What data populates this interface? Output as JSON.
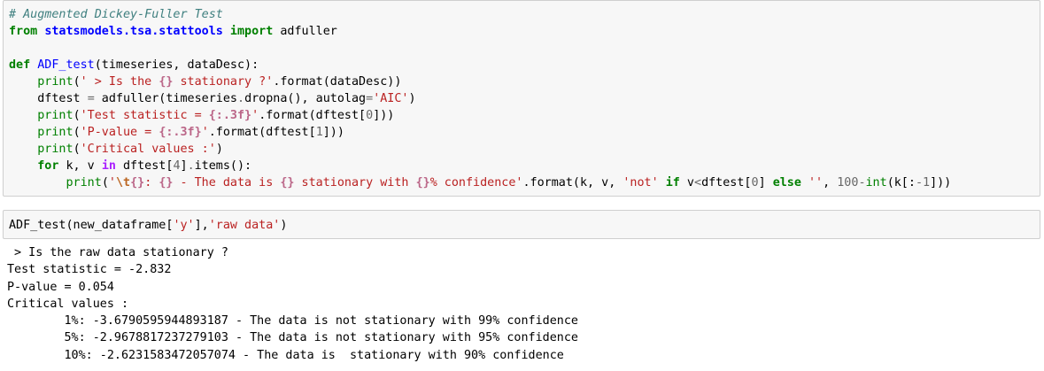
{
  "cell1": {
    "l1": {
      "t0": "# Augmented Dickey-Fuller Test"
    },
    "l2": {
      "t0": "from",
      "t1": " ",
      "t2": "statsmodels.tsa.stattools",
      "t3": " ",
      "t4": "import",
      "t5": " adfuller"
    },
    "l3": {
      "t0": ""
    },
    "l4": {
      "t0": "def",
      "t1": " ",
      "t2": "ADF_test",
      "t3": "(timeseries, dataDesc):"
    },
    "l5": {
      "t0": "    ",
      "t1": "print",
      "t2": "(",
      "t3": "' > Is the ",
      "t4": "{}",
      "t5": " stationary ?'",
      "t6": ".format(dataDesc))"
    },
    "l6": {
      "t0": "    dftest ",
      "t1": "=",
      "t2": " adfuller(timeseries",
      "t3": ".",
      "t4": "dropna(), autolag",
      "t5": "=",
      "t6": "'AIC'",
      "t7": ")"
    },
    "l7": {
      "t0": "    ",
      "t1": "print",
      "t2": "(",
      "t3": "'Test statistic = ",
      "t4": "{:.3f}",
      "t5": "'",
      "t6": ".format(dftest[",
      "t7": "0",
      "t8": "]))"
    },
    "l8": {
      "t0": "    ",
      "t1": "print",
      "t2": "(",
      "t3": "'P-value = ",
      "t4": "{:.3f}",
      "t5": "'",
      "t6": ".format(dftest[",
      "t7": "1",
      "t8": "]))"
    },
    "l9": {
      "t0": "    ",
      "t1": "print",
      "t2": "(",
      "t3": "'Critical values :'",
      "t4": ")"
    },
    "l10": {
      "t0": "    ",
      "t1": "for",
      "t2": " k, v ",
      "t3": "in",
      "t4": " dftest[",
      "t5": "4",
      "t6": "]",
      "t7": ".",
      "t8": "items():"
    },
    "l11": {
      "t0": "        ",
      "t1": "print",
      "t2": "(",
      "t3": "'",
      "t4": "\\t",
      "t5": "{}",
      "t6": ": ",
      "t7": "{}",
      "t8": " - The data is ",
      "t9": "{}",
      "t10": " stationary with ",
      "t11": "{}",
      "t12": "% confidence'",
      "t13": ".format(k, v, ",
      "t14": "'not'",
      "t15": " ",
      "t16": "if",
      "t17": " v",
      "t18": "<",
      "t19": "dftest[",
      "t20": "0",
      "t21": "] ",
      "t22": "else",
      "t23": " ",
      "t24": "''",
      "t25": ", ",
      "t26": "100",
      "t27": "-",
      "t28": "int",
      "t29": "(k[:",
      "t30": "-1",
      "t31": "]))"
    }
  },
  "cell2": {
    "l1": {
      "t0": "ADF_test(new_dataframe[",
      "t1": "'y'",
      "t2": "],",
      "t3": "'raw data'",
      "t4": ")"
    }
  },
  "output": {
    "lines": [
      " > Is the raw data stationary ?",
      "Test statistic = -2.832",
      "P-value = 0.054",
      "Critical values :",
      "\t1%: -3.6790595944893187 - The data is not stationary with 99% confidence",
      "\t5%: -2.9678817237279103 - The data is not stationary with 95% confidence",
      "\t10%: -2.6231583472057074 - The data is  stationary with 90% confidence"
    ]
  }
}
